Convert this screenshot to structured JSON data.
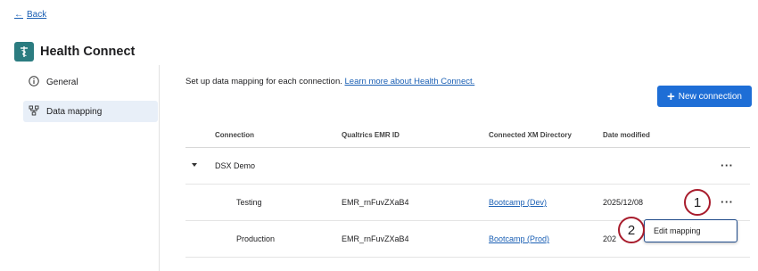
{
  "back": {
    "label": "Back"
  },
  "app": {
    "title": "Health Connect"
  },
  "sidebar": {
    "items": [
      {
        "label": "General",
        "icon": "info-icon",
        "active": false
      },
      {
        "label": "Data mapping",
        "icon": "data-mapping-icon",
        "active": true
      }
    ]
  },
  "main": {
    "intro": "Set up data mapping for each connection.",
    "learn_more": "Learn more about Health Connect.",
    "new_connection_label": "New connection",
    "table": {
      "headers": [
        "Connection",
        "Qualtrics EMR ID",
        "Connected XM Directory",
        "Date modified"
      ],
      "group": {
        "name": "DSX Demo"
      },
      "rows": [
        {
          "connection": "Testing",
          "emr_id": "EMR_rnFuvZXaB4",
          "directory": "Bootcamp (Dev)",
          "date": "2025/12/08"
        },
        {
          "connection": "Production",
          "emr_id": "EMR_rnFuvZXaB4",
          "directory": "Bootcamp (Prod)",
          "date": "202"
        }
      ]
    },
    "menu": {
      "edit_label": "Edit mapping"
    }
  },
  "callouts": [
    "1",
    "2"
  ],
  "colors": {
    "accent": "#1e6ed6",
    "link": "#1a5fb4",
    "callout_ring": "#a81c2c",
    "logo": "#2b7c80"
  }
}
